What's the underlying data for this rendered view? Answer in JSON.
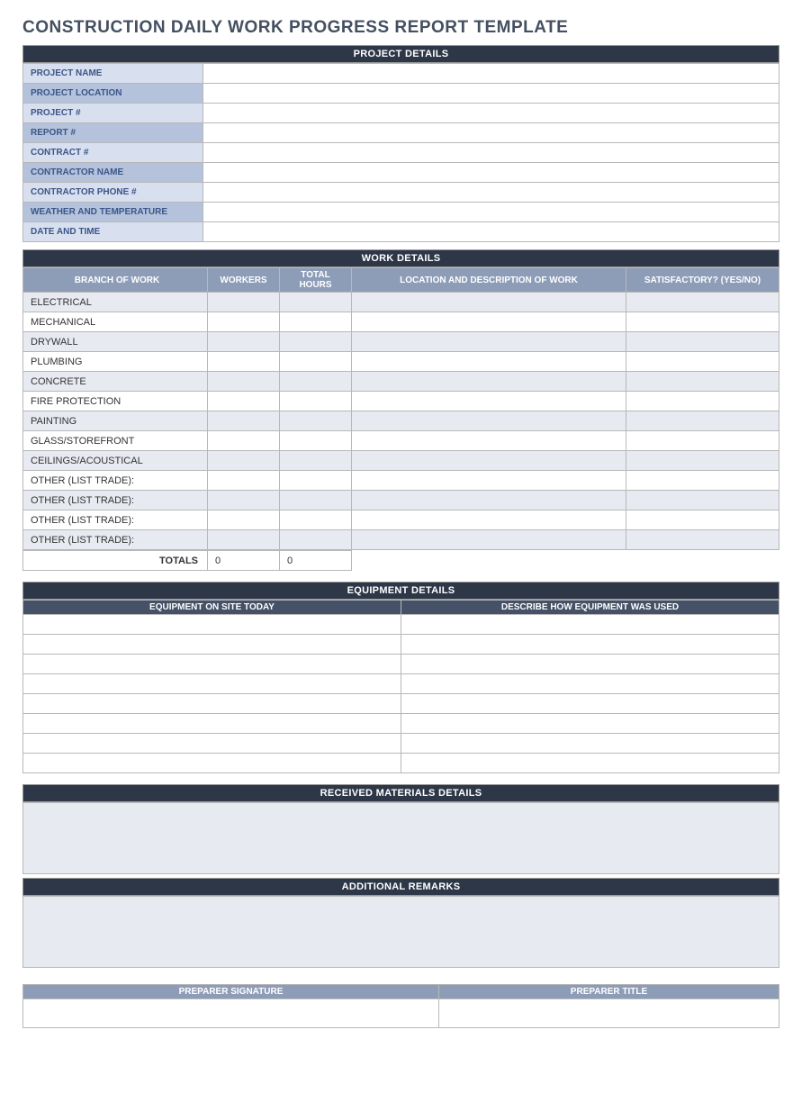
{
  "title": "CONSTRUCTION DAILY WORK PROGRESS REPORT TEMPLATE",
  "project": {
    "header": "PROJECT DETAILS",
    "rows": [
      {
        "label": "PROJECT NAME",
        "value": "",
        "shade": "light"
      },
      {
        "label": "PROJECT LOCATION",
        "value": "",
        "shade": "dark"
      },
      {
        "label": "PROJECT #",
        "value": "",
        "shade": "light"
      },
      {
        "label": "REPORT #",
        "value": "",
        "shade": "dark"
      },
      {
        "label": "CONTRACT #",
        "value": "",
        "shade": "light"
      },
      {
        "label": "CONTRACTOR NAME",
        "value": "",
        "shade": "dark"
      },
      {
        "label": "CONTRACTOR PHONE #",
        "value": "",
        "shade": "light"
      },
      {
        "label": "WEATHER AND TEMPERATURE",
        "value": "",
        "shade": "dark"
      },
      {
        "label": "DATE AND TIME",
        "value": "",
        "shade": "light"
      }
    ]
  },
  "work": {
    "header": "WORK DETAILS",
    "columns": {
      "branch": "BRANCH OF WORK",
      "workers": "WORKERS",
      "hours": "TOTAL HOURS",
      "location": "LOCATION AND DESCRIPTION OF WORK",
      "satisfactory": "SATISFACTORY? (YES/NO)"
    },
    "rows": [
      {
        "branch": "ELECTRICAL",
        "workers": "",
        "hours": "",
        "loc": "",
        "sat": "",
        "shade": true
      },
      {
        "branch": "MECHANICAL",
        "workers": "",
        "hours": "",
        "loc": "",
        "sat": "",
        "shade": false
      },
      {
        "branch": "DRYWALL",
        "workers": "",
        "hours": "",
        "loc": "",
        "sat": "",
        "shade": true
      },
      {
        "branch": "PLUMBING",
        "workers": "",
        "hours": "",
        "loc": "",
        "sat": "",
        "shade": false
      },
      {
        "branch": "CONCRETE",
        "workers": "",
        "hours": "",
        "loc": "",
        "sat": "",
        "shade": true
      },
      {
        "branch": "FIRE PROTECTION",
        "workers": "",
        "hours": "",
        "loc": "",
        "sat": "",
        "shade": false
      },
      {
        "branch": "PAINTING",
        "workers": "",
        "hours": "",
        "loc": "",
        "sat": "",
        "shade": true
      },
      {
        "branch": "GLASS/STOREFRONT",
        "workers": "",
        "hours": "",
        "loc": "",
        "sat": "",
        "shade": false
      },
      {
        "branch": "CEILINGS/ACOUSTICAL",
        "workers": "",
        "hours": "",
        "loc": "",
        "sat": "",
        "shade": true
      },
      {
        "branch": "OTHER (LIST TRADE):",
        "workers": "",
        "hours": "",
        "loc": "",
        "sat": "",
        "shade": false
      },
      {
        "branch": "OTHER (LIST TRADE):",
        "workers": "",
        "hours": "",
        "loc": "",
        "sat": "",
        "shade": true
      },
      {
        "branch": "OTHER (LIST TRADE):",
        "workers": "",
        "hours": "",
        "loc": "",
        "sat": "",
        "shade": false
      },
      {
        "branch": "OTHER (LIST TRADE):",
        "workers": "",
        "hours": "",
        "loc": "",
        "sat": "",
        "shade": true
      }
    ],
    "totals": {
      "label": "TOTALS",
      "workers": "0",
      "hours": "0"
    }
  },
  "equipment": {
    "header": "EQUIPMENT DETAILS",
    "columns": {
      "onsite": "EQUIPMENT ON SITE TODAY",
      "usage": "DESCRIBE HOW EQUIPMENT WAS USED"
    },
    "rows_count": 8
  },
  "materials": {
    "header": "RECEIVED MATERIALS DETAILS",
    "value": ""
  },
  "remarks": {
    "header": "ADDITIONAL REMARKS",
    "value": ""
  },
  "signature": {
    "columns": {
      "sig": "PREPARER SIGNATURE",
      "title": "PREPARER TITLE"
    },
    "sig_value": "",
    "title_value": ""
  }
}
